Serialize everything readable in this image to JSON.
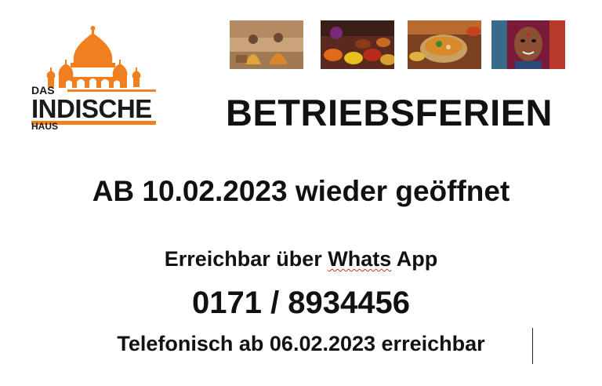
{
  "logo": {
    "das": "DAS",
    "indische": "INDISCHE",
    "haus": "HAUS",
    "brand_color": "#f07f20",
    "icon": "palace-domes-icon"
  },
  "photos": [
    {
      "name": "sadhus-photo",
      "icon": "sitting-men-photo"
    },
    {
      "name": "spices-market-photo",
      "icon": "spice-bowls-photo"
    },
    {
      "name": "curry-dish-photo",
      "icon": "food-bowl-photo"
    },
    {
      "name": "woman-portrait-photo",
      "icon": "portrait-photo"
    }
  ],
  "headline": "BETRIEBSFERIEN",
  "reopen": "AB 10.02.2023 wieder geöffnet",
  "contact": {
    "reach_prefix": "Erreichbar über ",
    "whatsapp": "Whats",
    "reach_suffix": " App",
    "phone": "0171 / 8934456",
    "phone_note": "Telefonisch ab 06.02.2023 erreichbar"
  },
  "colors": {
    "text": "#111111",
    "accent_orange": "#f07f20",
    "spellcheck_underline": "#d0302b"
  }
}
